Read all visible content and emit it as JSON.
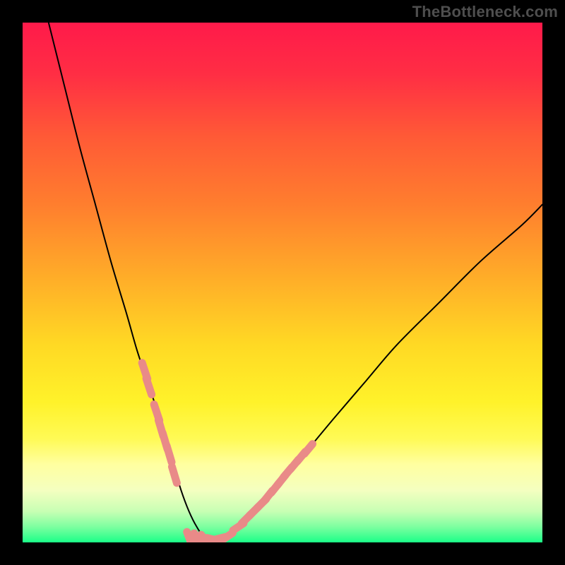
{
  "watermark": "TheBottleneck.com",
  "gradient": {
    "stops": [
      {
        "offset": 0.0,
        "color": "#ff1a4a"
      },
      {
        "offset": 0.1,
        "color": "#ff2e44"
      },
      {
        "offset": 0.22,
        "color": "#ff5a36"
      },
      {
        "offset": 0.35,
        "color": "#ff7e2e"
      },
      {
        "offset": 0.5,
        "color": "#ffb028"
      },
      {
        "offset": 0.62,
        "color": "#ffd924"
      },
      {
        "offset": 0.73,
        "color": "#fff22a"
      },
      {
        "offset": 0.8,
        "color": "#fffa55"
      },
      {
        "offset": 0.85,
        "color": "#ffffa0"
      },
      {
        "offset": 0.9,
        "color": "#f4ffc0"
      },
      {
        "offset": 0.94,
        "color": "#c8ffb4"
      },
      {
        "offset": 0.97,
        "color": "#7dffa0"
      },
      {
        "offset": 1.0,
        "color": "#1bff88"
      }
    ]
  },
  "chart_data": {
    "type": "line",
    "title": "",
    "xlabel": "",
    "ylabel": "",
    "xlim": [
      0,
      100
    ],
    "ylim": [
      0,
      100
    ],
    "series": [
      {
        "name": "bottleneck-curve",
        "x": [
          5,
          8,
          11,
          14,
          17,
          20,
          22,
          24,
          26,
          27.5,
          29,
          30.5,
          32,
          33.5,
          35,
          37,
          39,
          42,
          46,
          50,
          55,
          60,
          66,
          72,
          80,
          88,
          96,
          100
        ],
        "y": [
          100,
          88,
          76,
          65,
          54,
          44,
          37,
          31,
          25,
          20,
          15,
          10,
          6,
          3,
          1,
          0.5,
          1,
          3,
          7,
          12,
          18,
          24,
          31,
          38,
          46,
          54,
          61,
          65
        ]
      }
    ],
    "left_markers": {
      "name": "left-tick-marks",
      "color": "#e98a88",
      "points": [
        {
          "x": 23.5,
          "y": 33
        },
        {
          "x": 24.3,
          "y": 30
        },
        {
          "x": 25.8,
          "y": 25
        },
        {
          "x": 26.6,
          "y": 22
        },
        {
          "x": 27.4,
          "y": 19.5
        },
        {
          "x": 28.2,
          "y": 17
        },
        {
          "x": 29.2,
          "y": 13
        }
      ]
    },
    "right_markers": {
      "name": "right-tick-marks",
      "color": "#e98a88",
      "points": [
        {
          "x": 41.5,
          "y": 3
        },
        {
          "x": 43.0,
          "y": 4.5
        },
        {
          "x": 44.5,
          "y": 6
        },
        {
          "x": 46.0,
          "y": 7.5
        },
        {
          "x": 47.3,
          "y": 9
        },
        {
          "x": 48.6,
          "y": 10.5
        },
        {
          "x": 49.8,
          "y": 12
        },
        {
          "x": 51.0,
          "y": 13.5
        },
        {
          "x": 52.3,
          "y": 15
        },
        {
          "x": 53.6,
          "y": 16.5
        },
        {
          "x": 55.0,
          "y": 18
        }
      ]
    },
    "bottom_markers": {
      "name": "bottom-run",
      "color": "#e98a88",
      "points": [
        {
          "x": 32.0,
          "y": 1.0
        },
        {
          "x": 33.5,
          "y": 0.8
        },
        {
          "x": 35.0,
          "y": 0.6
        },
        {
          "x": 36.5,
          "y": 0.6
        },
        {
          "x": 38.0,
          "y": 0.8
        },
        {
          "x": 39.5,
          "y": 1.2
        }
      ]
    }
  }
}
